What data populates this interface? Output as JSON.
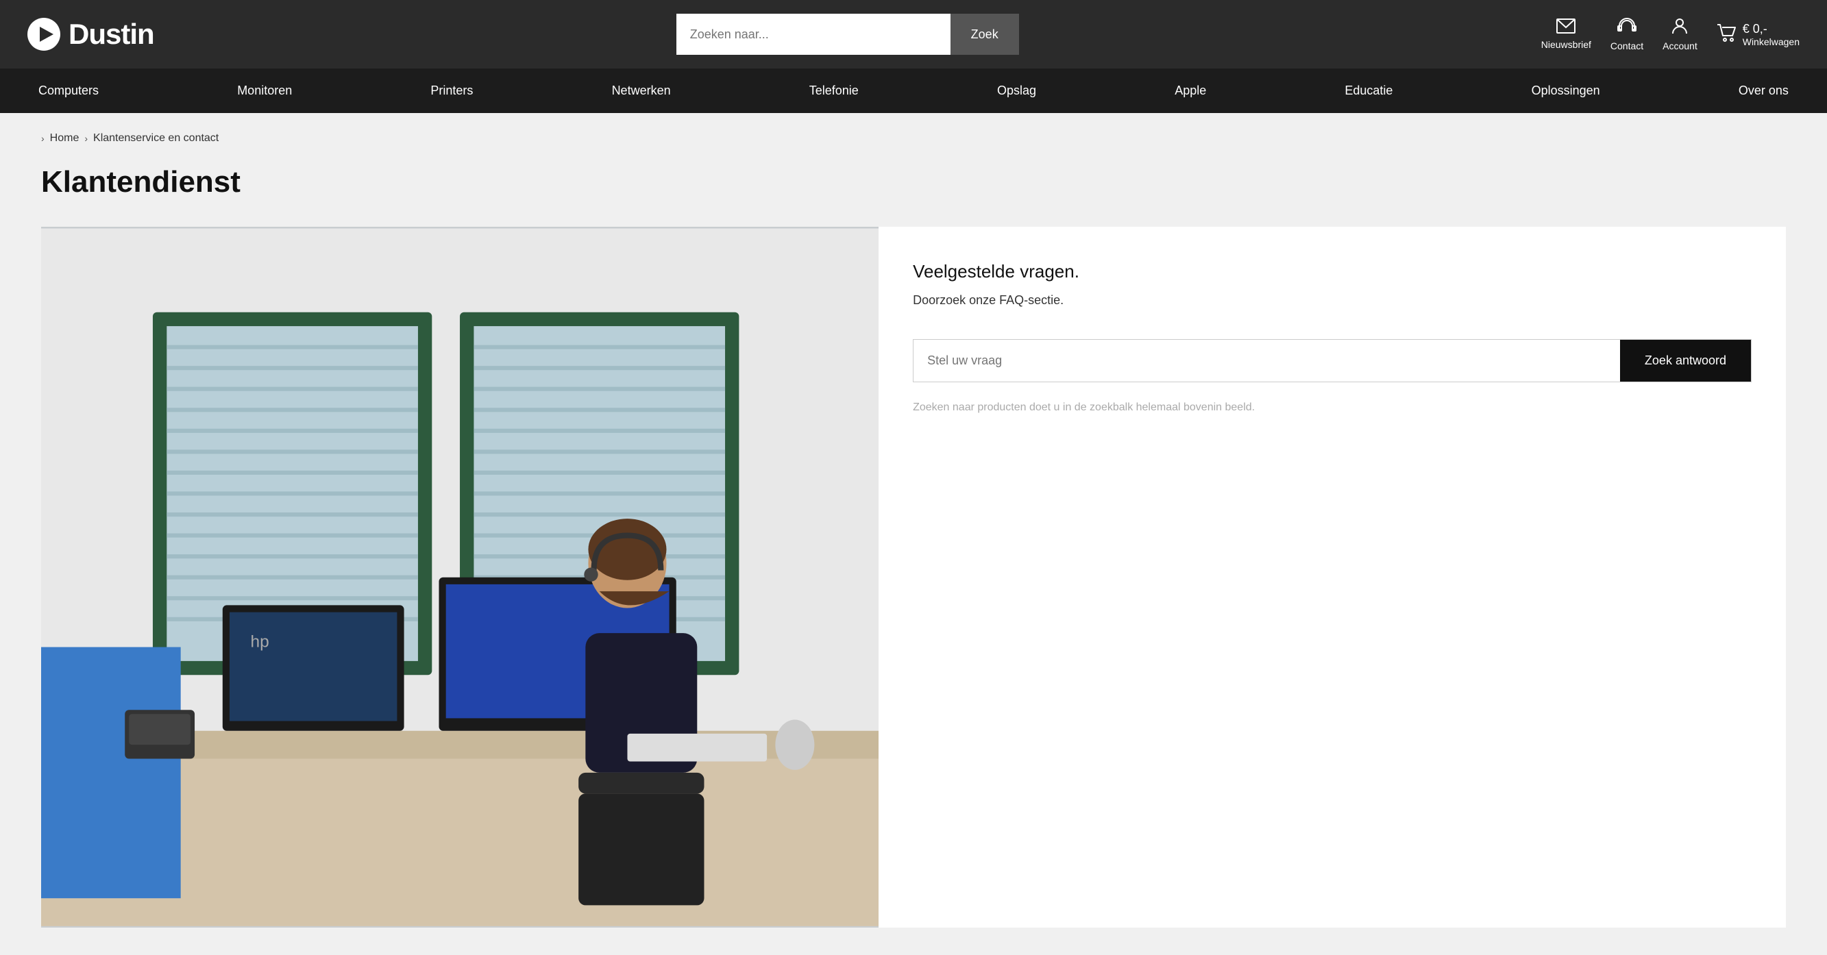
{
  "header": {
    "logo_text": "Dustin",
    "search_placeholder": "Zoeken naar...",
    "search_button": "Zoek",
    "newsletter_label": "Nieuwsbrief",
    "contact_label": "Contact",
    "account_label": "Account",
    "cart_label": "Winkelwagen",
    "cart_price": "€ 0,-"
  },
  "nav": {
    "items": [
      {
        "label": "Computers"
      },
      {
        "label": "Monitoren"
      },
      {
        "label": "Printers"
      },
      {
        "label": "Netwerken"
      },
      {
        "label": "Telefonie"
      },
      {
        "label": "Opslag"
      },
      {
        "label": "Apple"
      },
      {
        "label": "Educatie"
      },
      {
        "label": "Oplossingen"
      },
      {
        "label": "Over ons"
      }
    ]
  },
  "breadcrumb": {
    "home": "Home",
    "current": "Klantenservice en contact"
  },
  "page": {
    "title": "Klantendienst"
  },
  "faq_section": {
    "title": "Veelgestelde vragen.",
    "subtitle": "Doorzoek onze FAQ-sectie.",
    "input_placeholder": "Stel uw vraag",
    "button_label": "Zoek antwoord",
    "hint": "Zoeken naar producten doet u in de zoekbalk helemaal bovenin beeld."
  }
}
